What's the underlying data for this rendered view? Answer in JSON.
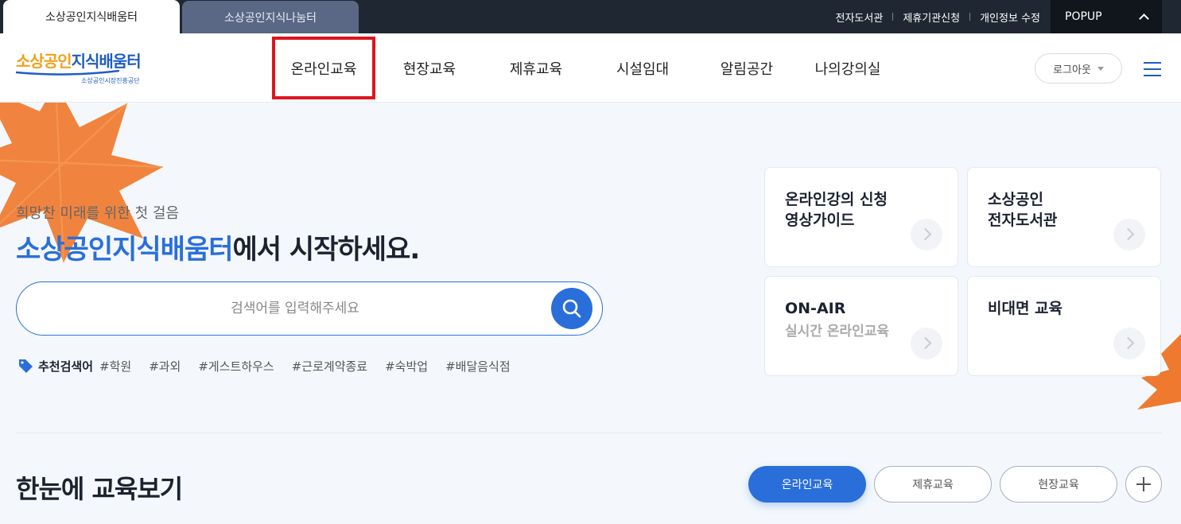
{
  "topbar": {
    "tabs": [
      {
        "label": "소상공인지식배움터",
        "active": true
      },
      {
        "label": "소상공인지식나눔터",
        "active": false
      }
    ],
    "links": [
      "전자도서관",
      "제휴기관신청",
      "개인정보 수정"
    ],
    "popup_label": "POPUP"
  },
  "header": {
    "logo": {
      "part1": "소상공인",
      "part2": "지식배움터",
      "sub": "소상공인시장진흥공단"
    },
    "nav": [
      "온라인교육",
      "현장교육",
      "제휴교육",
      "시설임대",
      "알림공간",
      "나의강의실"
    ],
    "logout_label": "로그아웃"
  },
  "hero": {
    "subtitle": "희망찬 미래를 위한 첫 걸음",
    "title_highlight": "소상공인지식배움터",
    "title_rest": "에서 시작하세요.",
    "search_placeholder": "검색어를 입력해주세요",
    "recommend_label": "추천검색어",
    "tags": [
      "#학원",
      "#과외",
      "#게스트하우스",
      "#근로계약종료",
      "#숙박업",
      "#배달음식점"
    ]
  },
  "cards": [
    {
      "title": "온라인강의 신청\n영상가이드",
      "sub": ""
    },
    {
      "title": "소상공인\n전자도서관",
      "sub": ""
    },
    {
      "title": "ON-AIR",
      "sub": "실시간 온라인교육"
    },
    {
      "title": "비대면 교육",
      "sub": ""
    }
  ],
  "section": {
    "title": "한눈에 교육보기",
    "filters": [
      "온라인교육",
      "제휴교육",
      "현장교육"
    ]
  },
  "colors": {
    "brand_blue": "#2a6fd9",
    "logo_orange": "#f0a11c",
    "topbar_bg": "#1f2733",
    "highlight_red": "#e0141e",
    "leaf_orange": "#ef7a2f"
  }
}
